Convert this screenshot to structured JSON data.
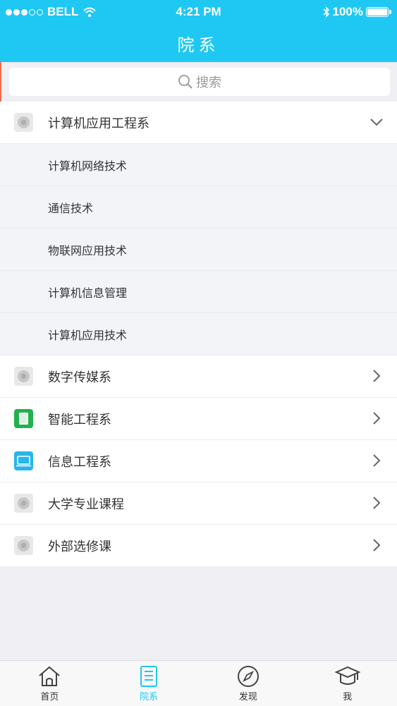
{
  "status_bar": {
    "carrier": "BELL",
    "time": "4:21 PM",
    "battery": "100%",
    "battery_level": 1.0
  },
  "nav": {
    "title": "院系"
  },
  "search": {
    "placeholder": "搜索"
  },
  "departments": [
    {
      "label": "计算机应用工程系",
      "icon": "gray-circle-icon",
      "expanded": true,
      "children": [
        "计算机网络技术",
        "通信技术",
        "物联网应用技术",
        "计算机信息管理",
        "计算机应用技术"
      ]
    },
    {
      "label": "数字传媒系",
      "icon": "gray-circle-icon",
      "expanded": false
    },
    {
      "label": "智能工程系",
      "icon": "green-book-icon",
      "expanded": false
    },
    {
      "label": "信息工程系",
      "icon": "blue-laptop-icon",
      "expanded": false
    },
    {
      "label": "大学专业课程",
      "icon": "gray-circle-icon",
      "expanded": false
    },
    {
      "label": "外部选修课",
      "icon": "gray-circle-icon",
      "expanded": false
    }
  ],
  "tabs": [
    {
      "label": "首页",
      "icon": "home-icon"
    },
    {
      "label": "院系",
      "icon": "list-icon",
      "active": true
    },
    {
      "label": "发现",
      "icon": "compass-icon"
    },
    {
      "label": "我",
      "icon": "graduation-cap-icon"
    }
  ],
  "colors": {
    "primary": "#1ec8f3",
    "accent_bar": "#f26a4b",
    "green_icon": "#22b14c",
    "blue_icon": "#28b5e8"
  }
}
